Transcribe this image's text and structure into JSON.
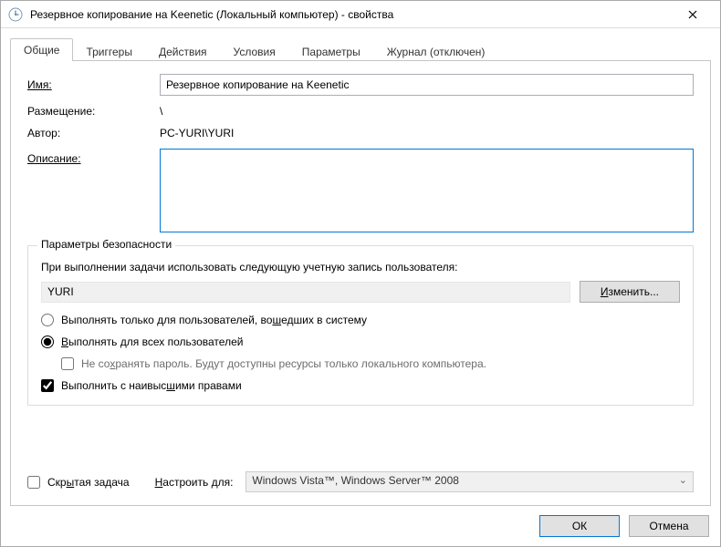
{
  "window": {
    "title": "Резервное копирование на Keenetic (Локальный компьютер) - свойства"
  },
  "tabs": {
    "general": "Общие",
    "triggers": "Триггеры",
    "actions": "Действия",
    "conditions": "Условия",
    "settings": "Параметры",
    "history": "Журнал (отключен)"
  },
  "labels": {
    "name": "Имя:",
    "location": "Размещение:",
    "author": "Автор:",
    "description": "Описание:"
  },
  "values": {
    "name": "Резервное копирование на Keenetic",
    "location": "\\",
    "author": "PC-YURI\\YURI",
    "description": ""
  },
  "security": {
    "group_title": "Параметры безопасности",
    "caption": "При выполнении задачи использовать следующую учетную запись пользователя:",
    "account": "YURI",
    "change_btn": "Изменить...",
    "change_hot": "И",
    "radio_logged_pre": "Выполнять только для пользователей, во",
    "radio_logged_hot": "ш",
    "radio_logged_post": "едших в систему",
    "radio_all_hot": "В",
    "radio_all_post": "ыполнять для всех пользователей",
    "nostore_pre": "Не со",
    "nostore_hot": "х",
    "nostore_post": "ранять пароль. Будут доступны ресурсы только локального компьютера.",
    "highest_pre": "Выполнить с наивыс",
    "highest_hot": "ш",
    "highest_post": "ими правами"
  },
  "bottom": {
    "hidden_pre": "Скр",
    "hidden_hot": "ы",
    "hidden_post": "тая задача",
    "configure_hot": "Н",
    "configure_post": "астроить для:",
    "combo_value": "Windows Vista™, Windows Server™ 2008"
  },
  "buttons": {
    "ok": "ОК",
    "cancel": "Отмена"
  }
}
